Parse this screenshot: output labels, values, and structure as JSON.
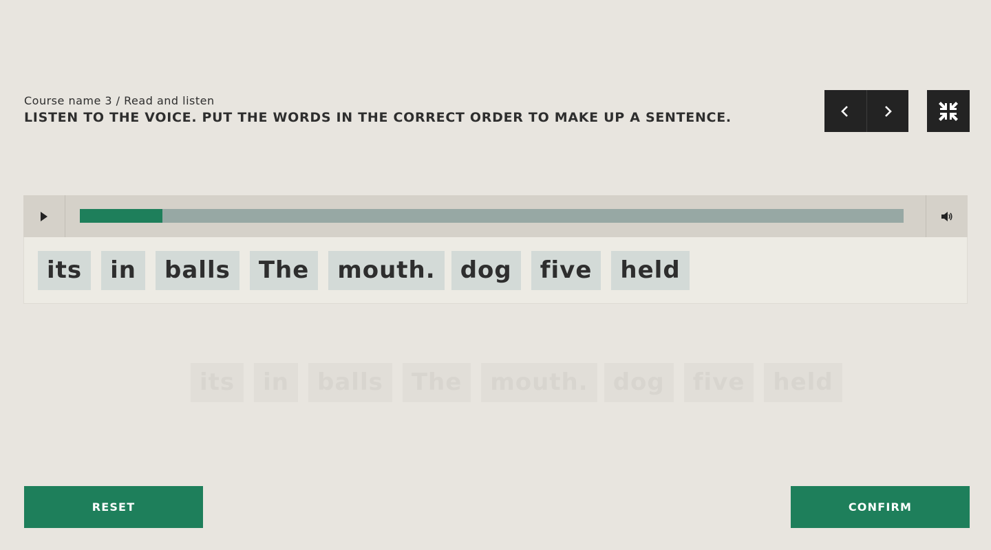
{
  "header": {
    "breadcrumb": "Course name 3 / Read and listen",
    "instruction": "LISTEN TO THE VOICE. PUT THE WORDS IN THE CORRECT ORDER TO MAKE UP A SENTENCE."
  },
  "navigation": {
    "prev_icon": "chevron-left-icon",
    "next_icon": "chevron-right-icon",
    "exit_fullscreen_icon": "compress-icon"
  },
  "player": {
    "play_icon": "play-icon",
    "volume_icon": "volume-icon",
    "progress_fraction": 0.1
  },
  "word_bank": {
    "words": [
      "its",
      "in",
      "balls",
      "The",
      "mouth.",
      "dog",
      "five",
      "held"
    ]
  },
  "answer_placeholders": {
    "words": [
      "its",
      "in",
      "balls",
      "The",
      "mouth.",
      "dog",
      "five",
      "held"
    ]
  },
  "actions": {
    "reset_label": "RESET",
    "confirm_label": "CONFIRM"
  },
  "colors": {
    "background": "#e8e5df",
    "accent": "#1e7f5b",
    "dark": "#232323",
    "word_tile": "#d3dad7",
    "progress_track": "#97a8a4"
  }
}
